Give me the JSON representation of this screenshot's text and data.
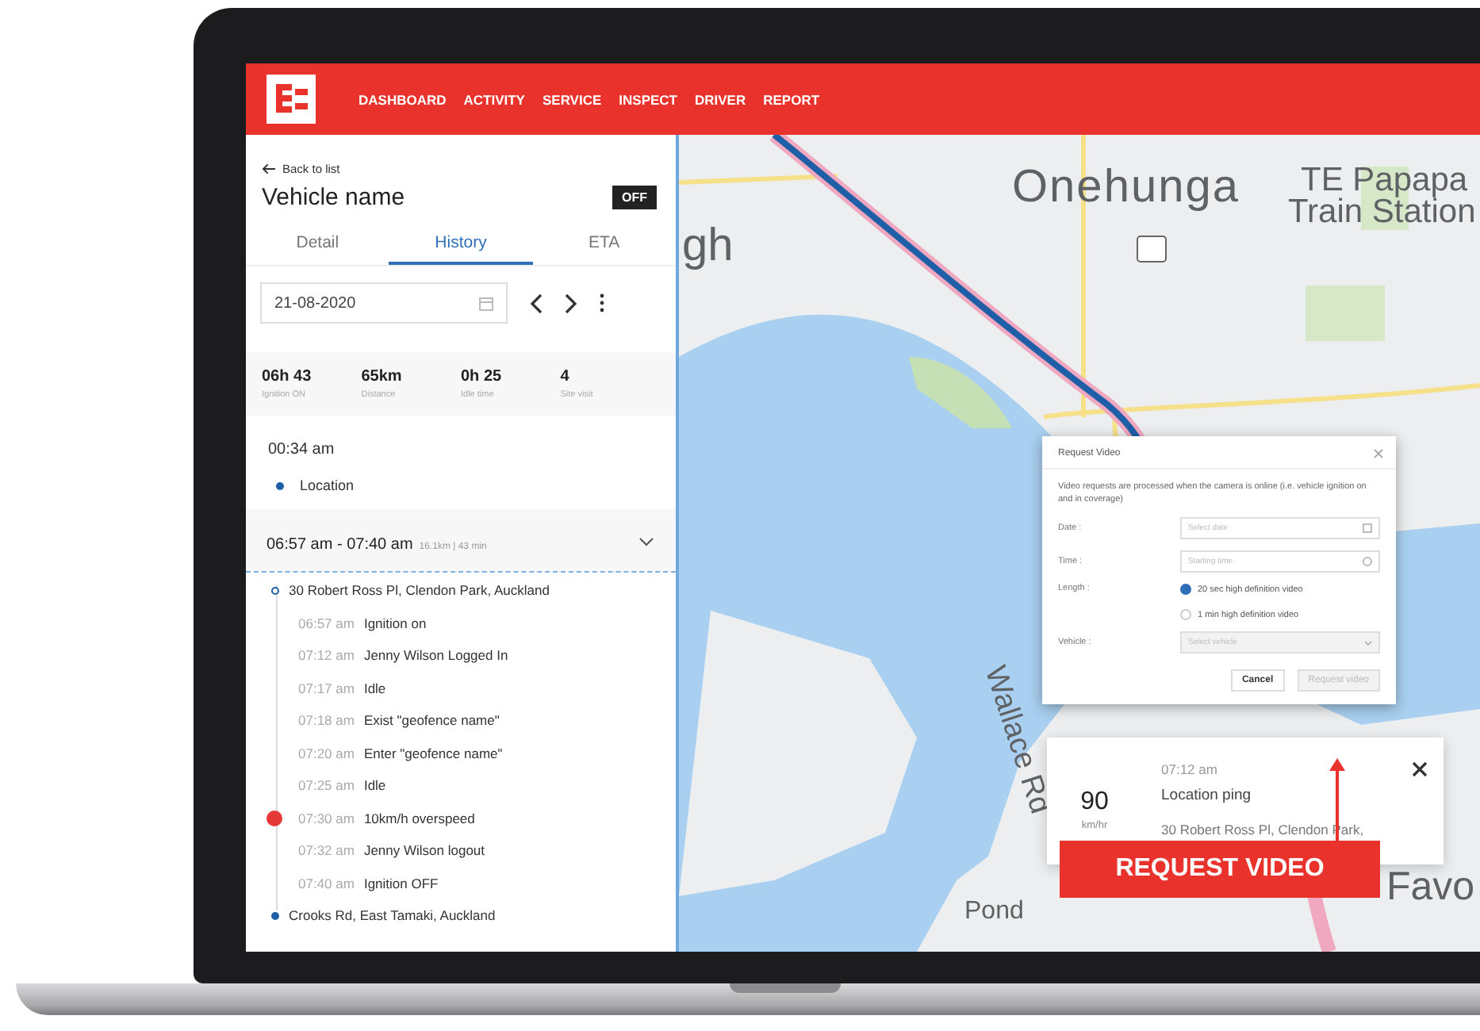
{
  "nav": {
    "items": [
      {
        "label": "DASHBOARD"
      },
      {
        "label": "ACTIVITY"
      },
      {
        "label": "SERVICE"
      },
      {
        "label": "INSPECT"
      },
      {
        "label": "DRIVER"
      },
      {
        "label": "REPORT"
      }
    ]
  },
  "panel": {
    "back": "Back to list",
    "title": "Vehicle name",
    "status": "OFF",
    "tabs": [
      {
        "label": "Detail",
        "selected": false
      },
      {
        "label": "History",
        "selected": true
      },
      {
        "label": "ETA",
        "selected": false
      }
    ],
    "date": "21-08-2020",
    "stats": [
      {
        "value": "06h 43",
        "label": "Ignition ON"
      },
      {
        "value": "65km",
        "label": "Distance"
      },
      {
        "value": "0h 25",
        "label": "Idle time"
      },
      {
        "value": "4",
        "label": "Site visit"
      }
    ],
    "first_entry": {
      "time": "00:34 am",
      "label": "Location"
    },
    "trip": {
      "range": "06:57 am - 07:40 am",
      "meta": "16.1km | 43 min",
      "expanded": true,
      "start": "30 Robert Ross Pl, Clendon Park, Auckland",
      "events": [
        {
          "time": "06:57 am",
          "label": "Ignition on",
          "kind": "normal"
        },
        {
          "time": "07:12 am",
          "label": "Jenny Wilson Logged In",
          "kind": "normal"
        },
        {
          "time": "07:17 am",
          "label": "Idle",
          "kind": "normal"
        },
        {
          "time": "07:18 am",
          "label": "Exist \"geofence name\"",
          "kind": "normal"
        },
        {
          "time": "07:20 am",
          "label": "Enter \"geofence name\"",
          "kind": "normal"
        },
        {
          "time": "07:25 am",
          "label": "Idle",
          "kind": "normal"
        },
        {
          "time": "07:30 am",
          "label": "10km/h overspeed",
          "kind": "alert"
        },
        {
          "time": "07:32 am",
          "label": "Jenny Wilson logout",
          "kind": "normal"
        },
        {
          "time": "07:40 am",
          "label": "Ignition OFF",
          "kind": "normal"
        }
      ],
      "end": "Crooks Rd, East Tamaki, Auckland"
    }
  },
  "map": {
    "labels": [
      {
        "text": "Onehunga",
        "kind": "suburb"
      },
      {
        "text": "TE Papapa",
        "kind": "station"
      },
      {
        "text": "Train Station",
        "kind": "station2"
      },
      {
        "text": "gh",
        "kind": "edge"
      },
      {
        "text": "Wallace Rd",
        "kind": "road"
      },
      {
        "text": "Pond",
        "kind": "pond"
      },
      {
        "text": "Favo",
        "kind": "right"
      }
    ]
  },
  "dialog": {
    "title": "Request Video",
    "note": "Video requests are processed when the camera is online (i.e. vehicle ignition on and in coverage)",
    "date": {
      "label": "Date :",
      "placeholder": "Select date"
    },
    "time": {
      "label": "Time :",
      "placeholder": "Starting time"
    },
    "length": {
      "label": "Length :",
      "options": [
        {
          "label": "20 sec high definition video",
          "selected": true
        },
        {
          "label": "1 min high definition video",
          "selected": false
        }
      ]
    },
    "vehicle": {
      "label": "Vehicle :",
      "placeholder": "Select vehicle",
      "disabled": true
    },
    "buttons": [
      {
        "label": "Cancel",
        "disabled": false
      },
      {
        "label": "Request video",
        "disabled": true
      }
    ]
  },
  "info_card": {
    "speed": "90",
    "unit": "km/hr",
    "time": "07:12 am",
    "title": "Location ping",
    "address": "30 Robert Ross Pl, Clendon Park,"
  },
  "callout": "REQUEST VIDEO"
}
